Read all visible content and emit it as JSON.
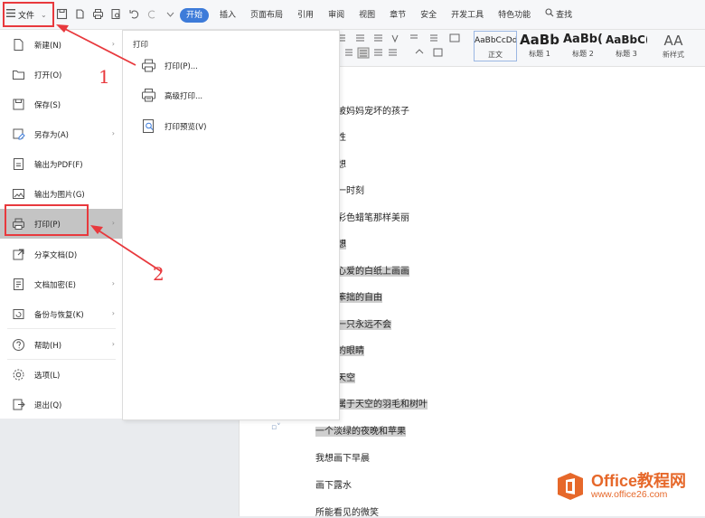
{
  "toolbar": {
    "file_label": "文件",
    "tabs": [
      "开始",
      "插入",
      "页面布局",
      "引用",
      "审阅",
      "视图",
      "章节",
      "安全",
      "开发工具",
      "特色功能"
    ],
    "search_label": "查找"
  },
  "ribbon": {
    "styles": [
      {
        "sample": "AaBbCcDd",
        "name": "正文"
      },
      {
        "sample": "AaBb",
        "name": "标题 1"
      },
      {
        "sample": "AaBb(",
        "name": "标题 2"
      },
      {
        "sample": "AaBbC(",
        "name": "标题 3"
      }
    ],
    "new_style_label": "新样式",
    "new_style_glyph": "AA"
  },
  "file_menu": {
    "items": [
      {
        "label": "新建(N)",
        "icon": "new-doc-icon",
        "arrow": true
      },
      {
        "label": "打开(O)",
        "icon": "folder-icon",
        "arrow": false
      },
      {
        "label": "保存(S)",
        "icon": "save-icon",
        "arrow": false
      },
      {
        "label": "另存为(A)",
        "icon": "save-as-icon",
        "arrow": true
      },
      {
        "label": "输出为PDF(F)",
        "icon": "pdf-icon",
        "arrow": false
      },
      {
        "label": "输出为图片(G)",
        "icon": "image-icon",
        "arrow": false
      },
      {
        "label": "打印(P)",
        "icon": "print-icon",
        "arrow": true,
        "selected": true
      },
      {
        "label": "分享文档(D)",
        "icon": "share-icon",
        "arrow": false
      },
      {
        "label": "文档加密(E)",
        "icon": "encrypt-icon",
        "arrow": true
      },
      {
        "label": "备份与恢复(K)",
        "icon": "backup-icon",
        "arrow": true
      },
      {
        "label": "帮助(H)",
        "icon": "help-icon",
        "arrow": true
      },
      {
        "label": "选项(L)",
        "icon": "gear-icon",
        "arrow": false
      },
      {
        "label": "退出(Q)",
        "icon": "exit-icon",
        "arrow": false
      }
    ]
  },
  "print_submenu": {
    "title": "打印",
    "items": [
      {
        "label": "打印(P)...",
        "icon": "print-icon"
      },
      {
        "label": "高级打印...",
        "icon": "advanced-print-icon"
      },
      {
        "label": "打印预览(V)",
        "icon": "print-preview-icon"
      }
    ]
  },
  "document": {
    "lines": [
      {
        "text": "被妈妈宠坏的孩子",
        "hl": false
      },
      {
        "text": "性",
        "hl": false
      },
      {
        "text": "想",
        "hl": false
      },
      {
        "text": "一时刻",
        "hl": false
      },
      {
        "text": "彩色蜡笔那样美丽",
        "hl": false
      },
      {
        "text": "想",
        "hl": true
      },
      {
        "text": "心爱的白纸上画画",
        "hl": true
      },
      {
        "text": "笨拙的自由",
        "hl": true
      },
      {
        "text": "一只永远不会",
        "hl": true
      },
      {
        "text": "的眼睛",
        "hl": true
      },
      {
        "text": "天空",
        "hl": true
      },
      {
        "text": "属于天空的羽毛和树叶",
        "hl": true
      },
      {
        "text": "一个淡绿的夜晚和苹果",
        "hl": true
      },
      {
        "text": "我想画下早晨",
        "hl": false
      },
      {
        "text": "画下露水",
        "hl": false
      },
      {
        "text": "所能看见的微笑",
        "hl": false
      }
    ]
  },
  "annotations": {
    "step1": "1",
    "step2": "2",
    "color": "#e8393d"
  },
  "watermark": {
    "line1": "Office教程网",
    "line2": "www.office26.com"
  }
}
